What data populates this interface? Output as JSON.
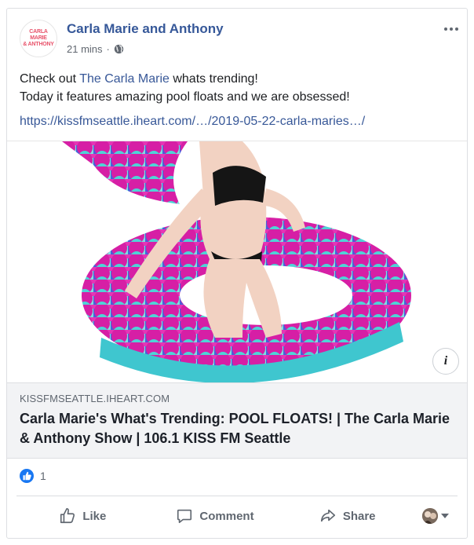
{
  "post": {
    "page_name": "Carla Marie and Anthony",
    "avatar_text_line1": "CARLA MARIE",
    "avatar_text_line2": "& ANTHONY",
    "time": "21 mins",
    "separator": "·",
    "audience_icon": "globe-icon",
    "more_icon": "more-options-icon",
    "text_before_link": "Check out ",
    "mention": "The Carla Marie",
    "text_after_link": " whats trending!",
    "text_line2": "Today it features amazing pool floats and we are obsessed!",
    "url": "https://kissfmseattle.iheart.com/…/2019-05-22-carla-maries…/"
  },
  "preview": {
    "domain": "KISSFMSEATTLE.IHEART.COM",
    "title": "Carla Marie's What's Trending: POOL FLOATS! | The Carla Marie & Anthony Show | 106.1 KISS FM Seattle",
    "info_label": "i"
  },
  "reactions": {
    "count": "1",
    "icon": "like-reaction-icon"
  },
  "actions": {
    "like": "Like",
    "comment": "Comment",
    "share": "Share"
  },
  "colors": {
    "link": "#385898",
    "name": "#365899",
    "like_blue": "#1877f2",
    "float_pink": "#e536b6",
    "float_blue": "#4a5ed9",
    "float_teal": "#4fd3d6"
  }
}
